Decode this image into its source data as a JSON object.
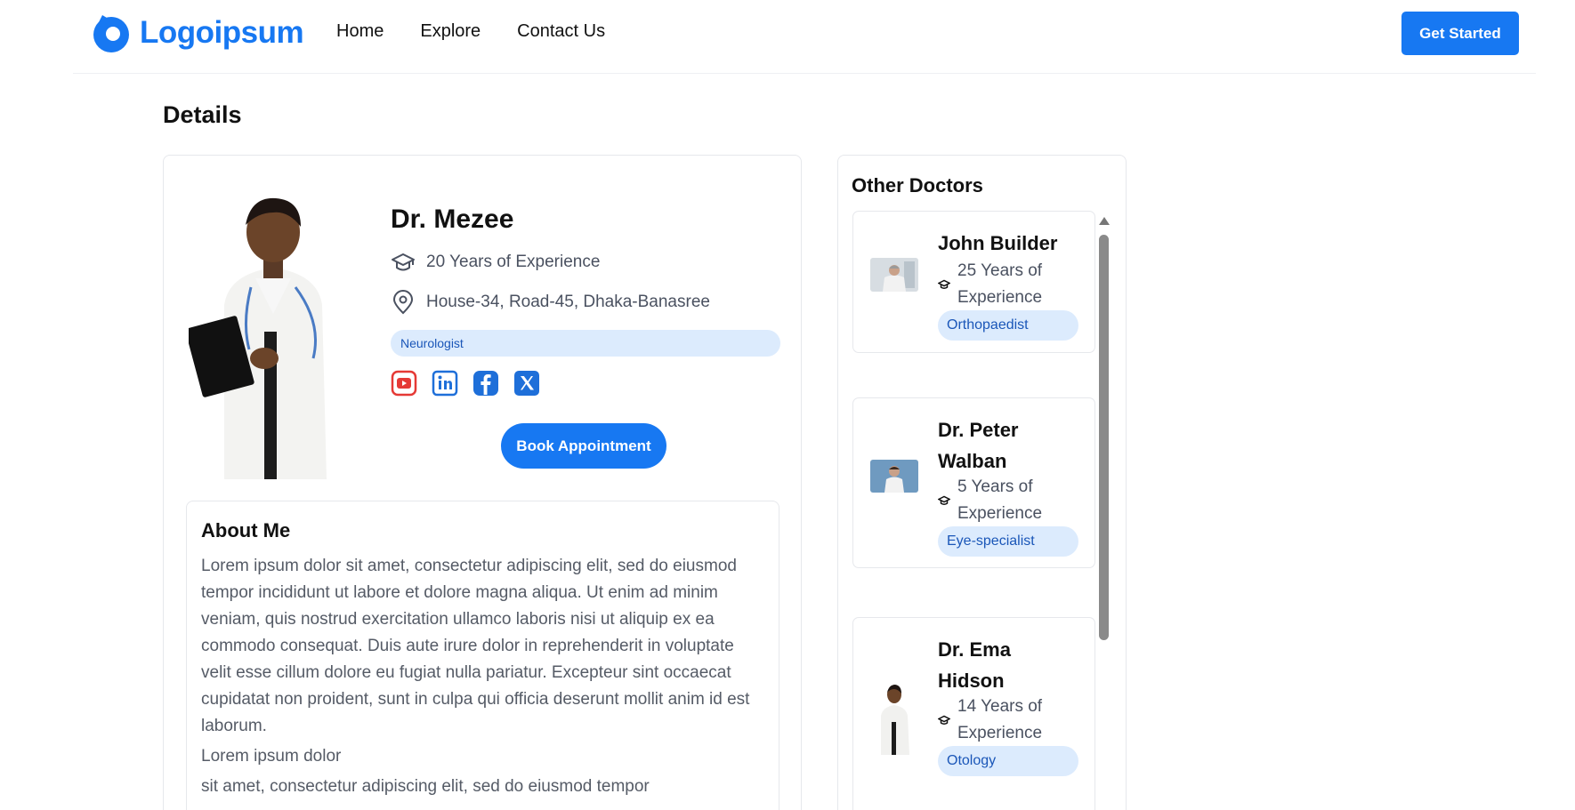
{
  "header": {
    "logo_text": "Logoipsum",
    "nav": [
      "Home",
      "Explore",
      "Contact Us"
    ],
    "cta_label": "Get Started"
  },
  "page": {
    "section_title": "Details"
  },
  "doctor": {
    "name": "Dr. Mezee",
    "experience": "20 Years of Experience",
    "address": "House-34, Road-45, Dhaka-Banasree",
    "specialty": "Neurologist",
    "socials": [
      "youtube-icon",
      "linkedin-icon",
      "facebook-icon",
      "x-icon"
    ],
    "book_label": "Book Appointment"
  },
  "about": {
    "title": "About Me",
    "body": "Lorem ipsum dolor sit amet, consectetur adipiscing elit, sed do eiusmod tempor incididunt ut labore et dolore magna aliqua. Ut enim ad minim veniam, quis nostrud exercitation ullamco laboris nisi ut aliquip ex ea commodo consequat. Duis aute irure dolor in reprehenderit in voluptate velit esse cillum dolore eu fugiat nulla pariatur. Excepteur sint occaecat cupidatat non proident, sunt in culpa qui officia deserunt mollit anim id est laborum.",
    "line2": "Lorem ipsum dolor",
    "line3": "sit amet, consectetur adipiscing elit, sed do eiusmod tempor"
  },
  "other_doctors": {
    "title": "Other Doctors",
    "items": [
      {
        "name": "John Builder",
        "experience": "25 Years of Experience",
        "specialty": "Orthopaedist"
      },
      {
        "name": "Dr. Peter Walban",
        "experience": "5 Years of Experience",
        "specialty": "Eye-specialist"
      },
      {
        "name": "Dr. Ema Hidson",
        "experience": "14 Years of Experience",
        "specialty": "Otology"
      }
    ]
  },
  "colors": {
    "brand": "#1778f2",
    "tag_bg": "#dcebfd",
    "tag_text": "#1a56b8",
    "youtube": "#e53935",
    "linkedin": "#1e6fd9"
  }
}
